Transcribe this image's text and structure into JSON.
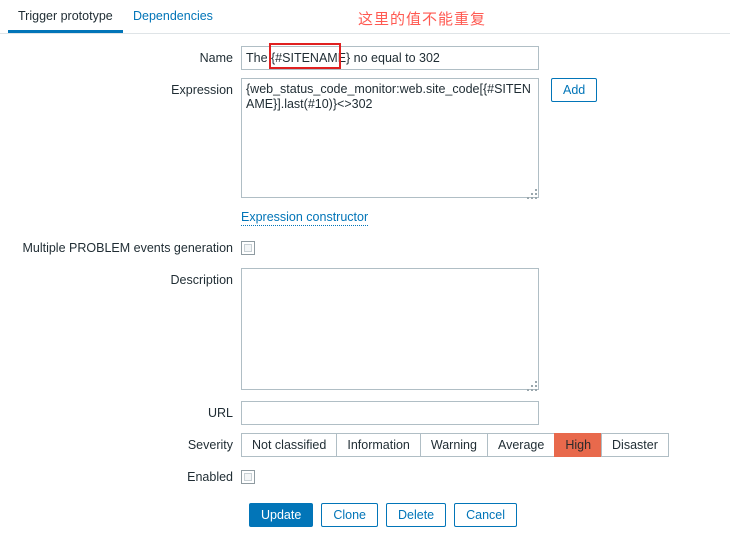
{
  "tabs": [
    {
      "label": "Trigger prototype",
      "active": true
    },
    {
      "label": "Dependencies",
      "active": false
    }
  ],
  "annotation": {
    "text": "这里的值不能重复",
    "color": "#ff5a52"
  },
  "form": {
    "name": {
      "label": "Name",
      "value": "The {#SITENAME} no equal to 302",
      "highlighted_token": "{#SITENAME}",
      "highlight_color": "#e02020"
    },
    "expression": {
      "label": "Expression",
      "value": "{web_status_code_monitor:web.site_code[{#SITENAME}].last(#10)}<>302",
      "add_button": "Add"
    },
    "expression_constructor": {
      "label": "Expression constructor"
    },
    "multiple_problem_events": {
      "label": "Multiple PROBLEM events generation",
      "checked": false
    },
    "description": {
      "label": "Description",
      "value": ""
    },
    "url": {
      "label": "URL",
      "value": ""
    },
    "severity": {
      "label": "Severity",
      "options": [
        "Not classified",
        "Information",
        "Warning",
        "Average",
        "High",
        "Disaster"
      ],
      "selected": "High",
      "selected_color": "#e8694c"
    },
    "enabled": {
      "label": "Enabled",
      "checked": false
    }
  },
  "actions": {
    "update": "Update",
    "clone": "Clone",
    "delete": "Delete",
    "cancel": "Cancel"
  },
  "theme": {
    "accent": "#0275b8",
    "border": "#b0bec5",
    "text": "#1f2c33"
  }
}
